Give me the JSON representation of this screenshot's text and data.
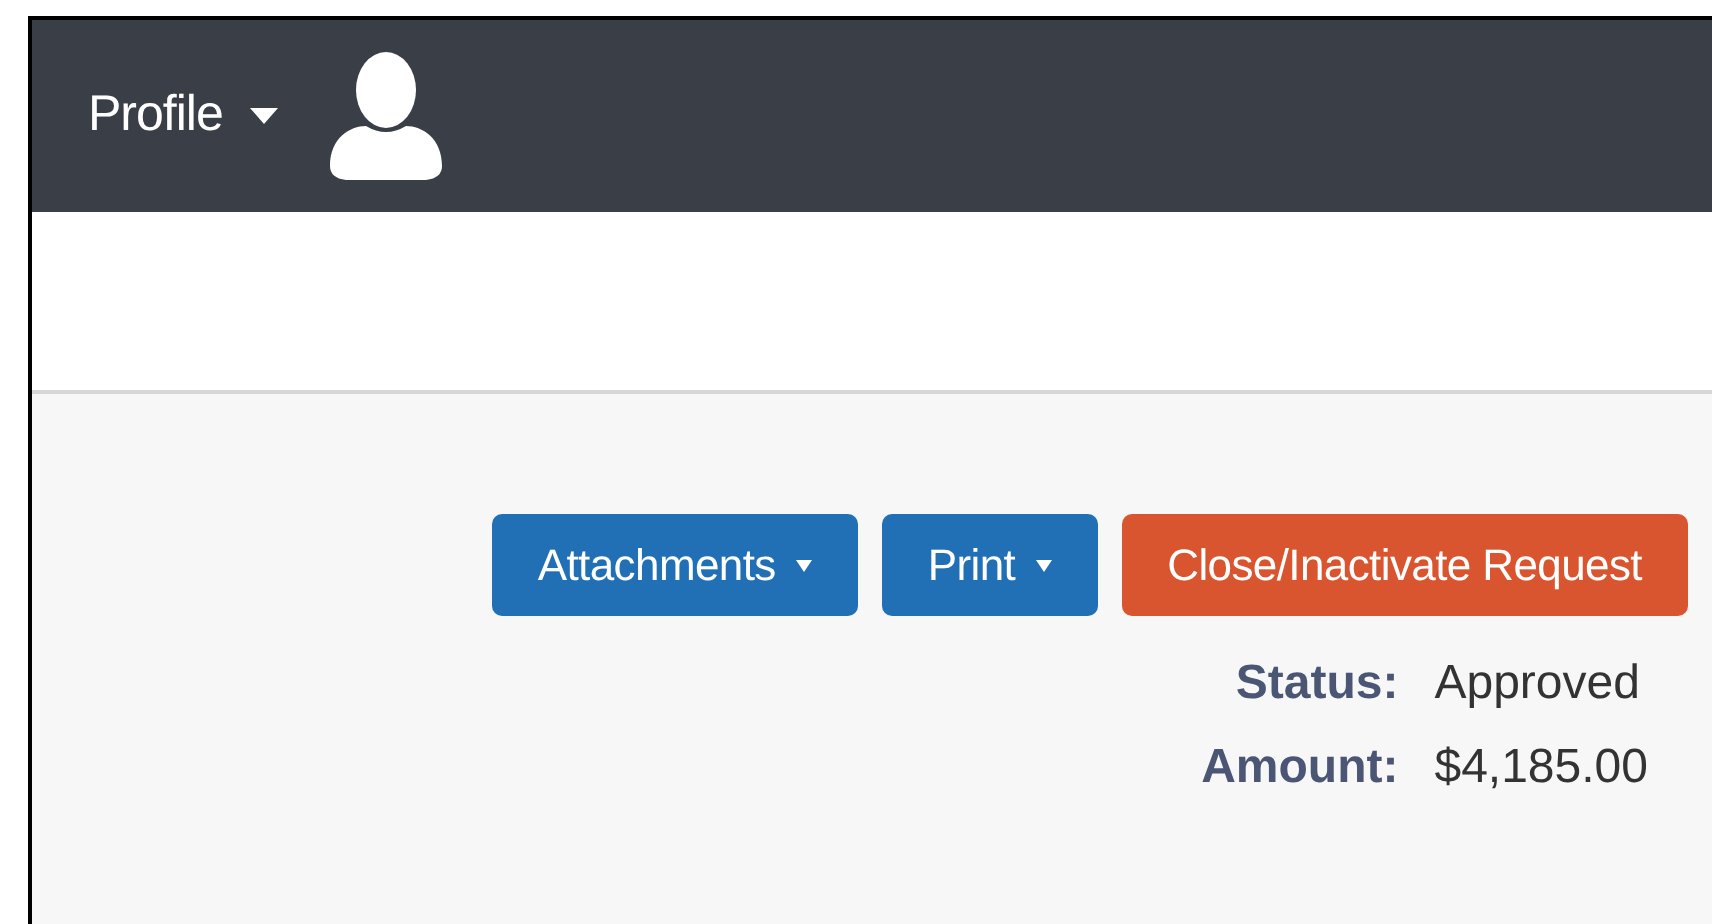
{
  "header": {
    "profile_menu": {
      "label": "Profile"
    }
  },
  "actions": [
    {
      "label": "Attachments",
      "kind": "dropdown",
      "color": "#2170b5"
    },
    {
      "label": "Print",
      "kind": "dropdown",
      "color": "#2170b5"
    },
    {
      "label": "Close/Inactivate Request",
      "kind": "plain",
      "color": "#d9552f"
    }
  ],
  "details": [
    {
      "label": "Status:",
      "value": "Approved"
    },
    {
      "label": "Amount:",
      "value": "$4,185.00"
    }
  ]
}
